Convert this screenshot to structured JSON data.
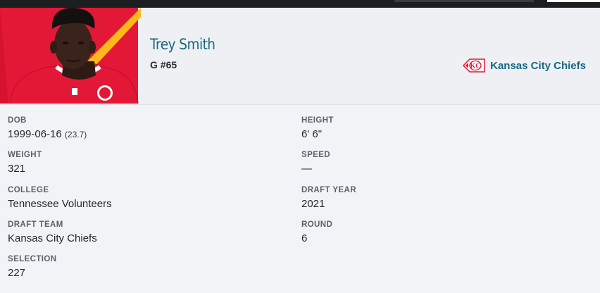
{
  "player": {
    "name": "Trey Smith",
    "position_number": "G #65",
    "team": "Kansas City Chiefs"
  },
  "icons": {
    "team_logo": "arrowhead-logo-icon"
  },
  "colors": {
    "accent_teal": "#17697f",
    "chiefs_red": "#e31837",
    "chiefs_gold": "#ffb81c"
  },
  "details": {
    "dob": {
      "label": "DOB",
      "value": "1999-06-16",
      "age": "(23.7)"
    },
    "height": {
      "label": "HEIGHT",
      "value": "6' 6\""
    },
    "weight": {
      "label": "WEIGHT",
      "value": "321"
    },
    "speed": {
      "label": "SPEED",
      "value": "—"
    },
    "college": {
      "label": "COLLEGE",
      "value": "Tennessee Volunteers"
    },
    "draft_year": {
      "label": "DRAFT YEAR",
      "value": "2021"
    },
    "draft_team": {
      "label": "DRAFT TEAM",
      "value": "Kansas City Chiefs"
    },
    "round": {
      "label": "ROUND",
      "value": "6"
    },
    "selection": {
      "label": "SELECTION",
      "value": "227"
    }
  }
}
